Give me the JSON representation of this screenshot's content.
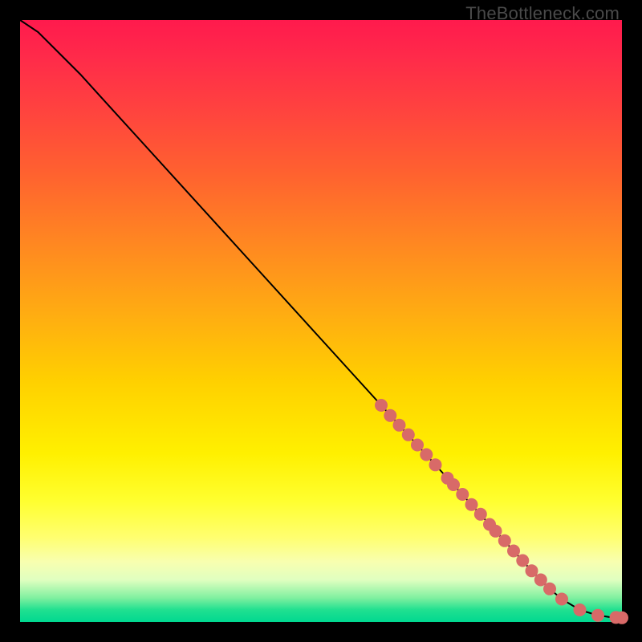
{
  "watermark": "TheBottleneck.com",
  "colors": {
    "frame": "#000000",
    "curve": "#000000",
    "marker": "#d86a68"
  },
  "chart_data": {
    "type": "line",
    "title": "",
    "xlabel": "",
    "ylabel": "",
    "xlim": [
      0,
      100
    ],
    "ylim": [
      0,
      100
    ],
    "series": [
      {
        "name": "curve",
        "x": [
          0,
          3,
          6,
          10,
          15,
          20,
          30,
          40,
          50,
          60,
          65,
          70,
          75,
          80,
          85,
          88,
          90,
          92,
          94,
          96,
          98,
          100
        ],
        "y": [
          100,
          98,
          95,
          91,
          85.5,
          80,
          69,
          58,
          47,
          36,
          30.5,
          25,
          19.5,
          14,
          8.5,
          5.5,
          3.8,
          2.6,
          1.7,
          1.1,
          0.8,
          0.7
        ]
      }
    ],
    "markers": {
      "name": "highlight-points",
      "x": [
        60,
        61.5,
        63,
        64.5,
        66,
        67.5,
        69,
        71,
        72,
        73.5,
        75,
        76.5,
        78,
        79,
        80.5,
        82,
        83.5,
        85,
        86.5,
        88,
        90,
        93,
        96,
        99,
        100
      ],
      "y": [
        36,
        34.3,
        32.7,
        31.1,
        29.4,
        27.8,
        26.1,
        23.9,
        22.8,
        21.2,
        19.5,
        17.9,
        16.2,
        15.1,
        13.5,
        11.8,
        10.2,
        8.5,
        7.0,
        5.5,
        3.8,
        2.0,
        1.1,
        0.75,
        0.7
      ]
    },
    "gradient_stops": [
      {
        "pos": 0.0,
        "color": "#ff1a4d"
      },
      {
        "pos": 0.14,
        "color": "#ff4040"
      },
      {
        "pos": 0.38,
        "color": "#ff8a20"
      },
      {
        "pos": 0.6,
        "color": "#ffd000"
      },
      {
        "pos": 0.8,
        "color": "#ffff30"
      },
      {
        "pos": 0.93,
        "color": "#e0ffc0"
      },
      {
        "pos": 1.0,
        "color": "#00d890"
      }
    ]
  }
}
